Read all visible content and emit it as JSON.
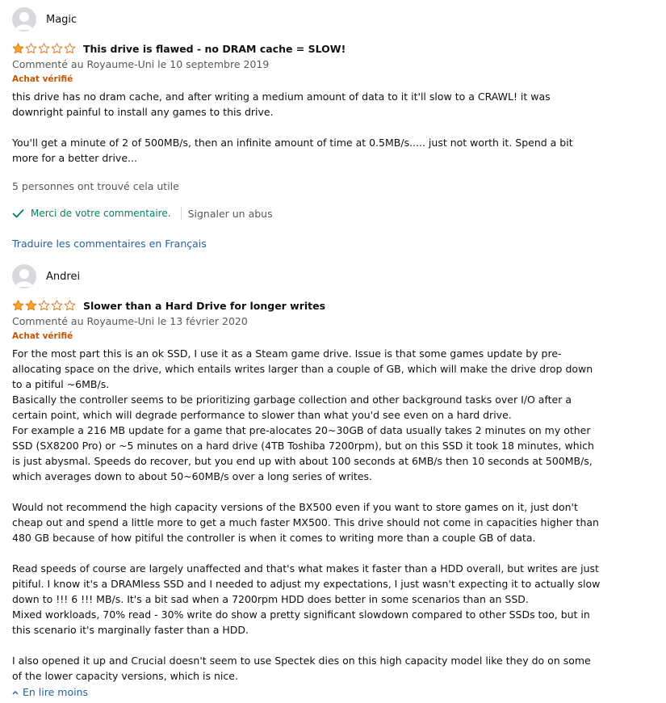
{
  "reviews": [
    {
      "author": "Magic",
      "rating": 1,
      "max_rating": 5,
      "title": "This drive is flawed - no DRAM cache = SLOW!",
      "meta": "Commenté au Royaume-Uni le 10 septembre 2019",
      "badge": "Achat vérifié",
      "body": [
        "this drive has no dram cache, and after writing a medium amount of data to it it'll slow to a CRAWL! it was\ndownright painful to install any games to this drive.\n\nYou'll get a minute of 2 of 500MB/s, then an infinite amount of time at 0.5MB/s..... just not worth it. Spend a bit\nmore for a better drive..."
      ],
      "helpful": "5 personnes ont trouvé cela utile",
      "thanks_label": "Merci de votre commentaire.",
      "report_label": "Signaler un abus",
      "translate_label": "Traduire les commentaires en Français"
    },
    {
      "author": "Andrei",
      "rating": 2,
      "max_rating": 5,
      "title": "Slower than a Hard Drive for longer writes",
      "meta": "Commenté au Royaume-Uni le 13 février 2020",
      "badge": "Achat vérifié",
      "body": [
        "For the most part this is an ok SSD, I use it as a Steam game drive. Issue is that some games update by pre-\nallocating space on the drive, which entails writes larger than a couple of GB, which will make the drive drop down\nto a pitiful ~6MB/s.\nBasically the controller seems to be prioritizing garbage collection and other background tasks over I/O after a\ncertain point, which will degrade performance to slower than what you'd see even on a hard drive.\nFor example a 216 MB update for a game that pre-alocates 20~30GB of data usually takes 2 minutes on my other\nSSD (SX8200 Pro) or ~5 minutes on a hard drive (4TB Toshiba 7200rpm), but on this SSD it took 18 minutes, which\nis just abysmal. Speeds do recover, but you end up with about 100 seconds at 6MB/s then 10 seconds at 500MB/s,\nwhich averages down to about 50~60MB/s over a long series of writes.\n\nWould not recommend the high capacity versions of the BX500 even if you want to store games on it, just don't\ncheap out and spend a little more to get a much faster MX500. This drive should not come in capacities higher than\n480 GB because of how pitiful the controller is when it comes to writing more than a couple GB of data.\n\nRead speeds of course are largely unaffected and that's what makes it faster than a HDD overall, but writes are just\npitiful. I know it's a DRAMless SSD and I needed to adjust my expectations, I just wasn't expecting it to actually slow\ndown to !!! 6 !!! MB/s. It's a bit sad when a 7200rpm HDD does better in some scenarios than an SSD.\nMixed workloads, 70% read - 30% write do show a pretty significant slowdown compared to other SSDs too, but in\nthis scenario it's marginally faster than a HDD.\n\nI also opened it up and Crucial doesn't seem to use Spectek dies on this high capacity model like they do on some\nof the lower capacity versions, which is nice."
      ],
      "read_less_label": "En lire moins"
    }
  ],
  "colors": {
    "star_fill": "#ffa41c",
    "star_stroke": "#de7921",
    "verified": "#c45500",
    "link": "#2162a1",
    "thanks": "#067d62"
  }
}
